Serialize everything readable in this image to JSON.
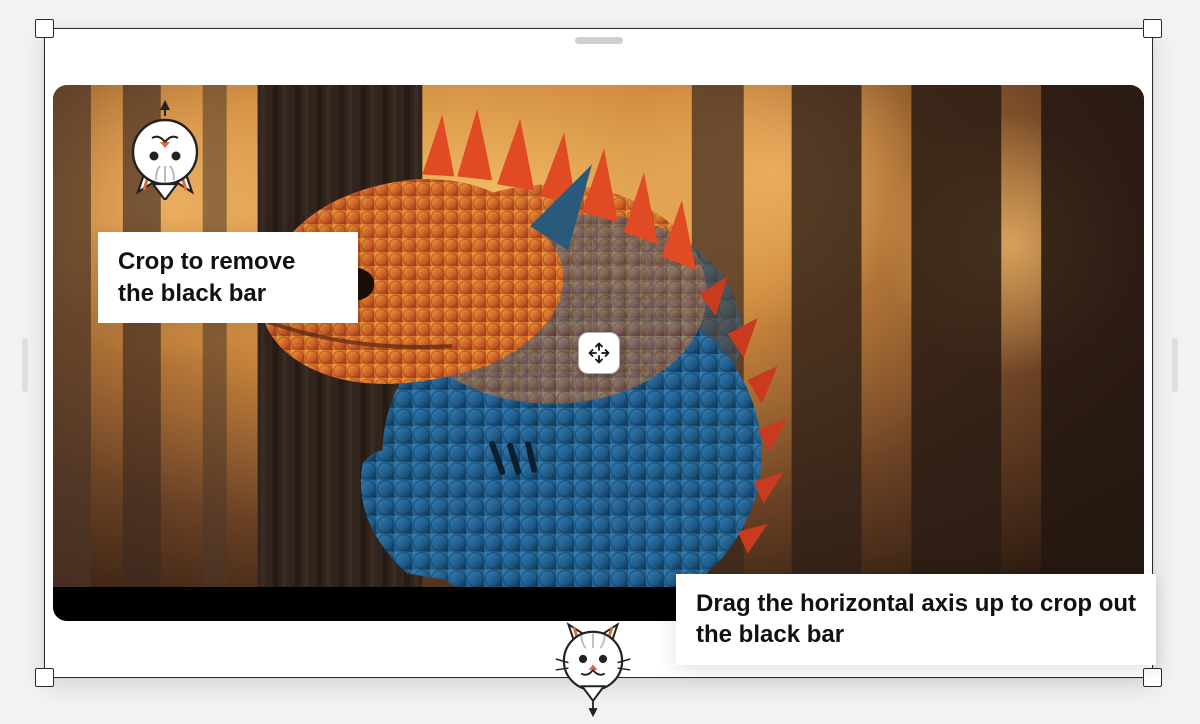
{
  "callouts": {
    "upper": "Crop to remove the black bar",
    "lower": "Drag the horizontal axis up to crop out the black bar"
  },
  "handles": {
    "move": "move-icon"
  }
}
